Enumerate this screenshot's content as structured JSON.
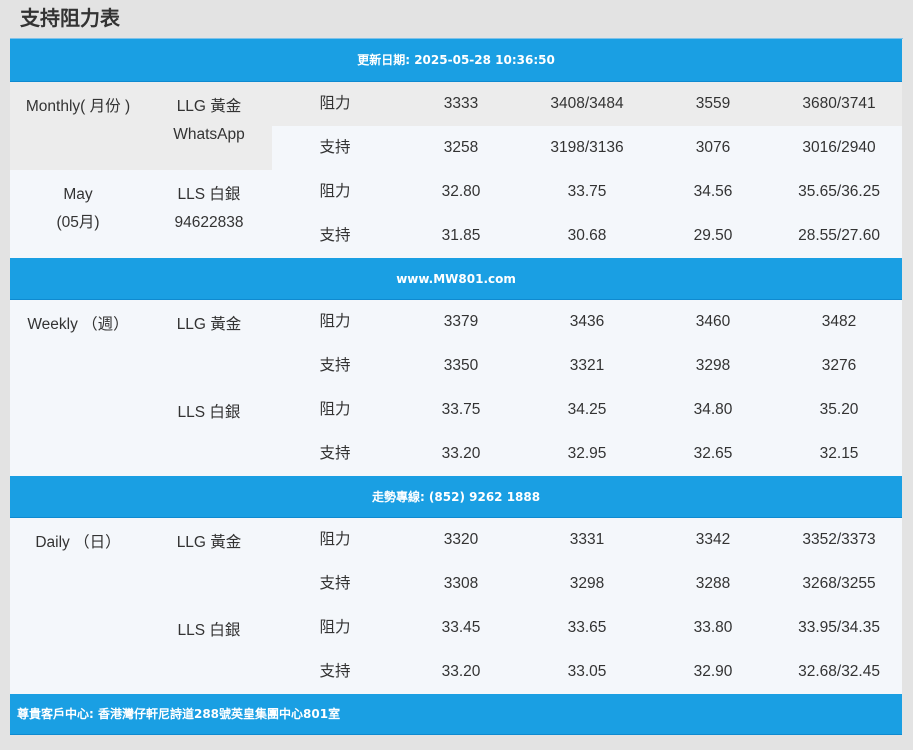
{
  "page": {
    "title": "支持阻力表"
  },
  "banners": {
    "updated": "更新日期: 2025-05-28 10:36:50",
    "website": "www.MW801.com",
    "hotline": "走勢專線: (852) 9262 1888",
    "footer": "尊貴客戶中心: 香港灣仔軒尼詩道288號英皇集團中心801室"
  },
  "sections": {
    "monthly": {
      "period_line1": "Monthly( 月份 )",
      "period_line2": "May",
      "period_line3": "(05月)",
      "gold_label": "LLG 黃金",
      "gold_sub": "WhatsApp",
      "silver_label": "LLS 白銀",
      "silver_sub": "94622838",
      "rows": [
        {
          "type": "阻力",
          "v1": "3333",
          "v2": "3408/3484",
          "v3": "3559",
          "v4": "3680/3741"
        },
        {
          "type": "支持",
          "v1": "3258",
          "v2": "3198/3136",
          "v3": "3076",
          "v4": "3016/2940"
        },
        {
          "type": "阻力",
          "v1": "32.80",
          "v2": "33.75",
          "v3": "34.56",
          "v4": "35.65/36.25"
        },
        {
          "type": "支持",
          "v1": "31.85",
          "v2": "30.68",
          "v3": "29.50",
          "v4": "28.55/27.60"
        }
      ]
    },
    "weekly": {
      "period": "Weekly （週）",
      "gold_label": "LLG 黃金",
      "silver_label": "LLS 白銀",
      "rows": [
        {
          "type": "阻力",
          "v1": "3379",
          "v2": "3436",
          "v3": "3460",
          "v4": "3482"
        },
        {
          "type": "支持",
          "v1": "3350",
          "v2": "3321",
          "v3": "3298",
          "v4": "3276"
        },
        {
          "type": "阻力",
          "v1": "33.75",
          "v2": "34.25",
          "v3": "34.80",
          "v4": "35.20"
        },
        {
          "type": "支持",
          "v1": "33.20",
          "v2": "32.95",
          "v3": "32.65",
          "v4": "32.15"
        }
      ]
    },
    "daily": {
      "period": "Daily （日）",
      "gold_label": "LLG 黃金",
      "silver_label": "LLS 白銀",
      "rows": [
        {
          "type": "阻力",
          "v1": "3320",
          "v2": "3331",
          "v3": "3342",
          "v4": "3352/3373"
        },
        {
          "type": "支持",
          "v1": "3308",
          "v2": "3298",
          "v3": "3288",
          "v4": "3268/3255"
        },
        {
          "type": "阻力",
          "v1": "33.45",
          "v2": "33.65",
          "v3": "33.80",
          "v4": "33.95/34.35"
        },
        {
          "type": "支持",
          "v1": "33.20",
          "v2": "33.05",
          "v3": "32.90",
          "v4": "32.68/32.45"
        }
      ]
    }
  },
  "colors": {
    "banner": "#1a9fe3",
    "row_light": "#f4f7fb",
    "row_grey": "#ececec",
    "page_bg": "#e3e3e3"
  }
}
